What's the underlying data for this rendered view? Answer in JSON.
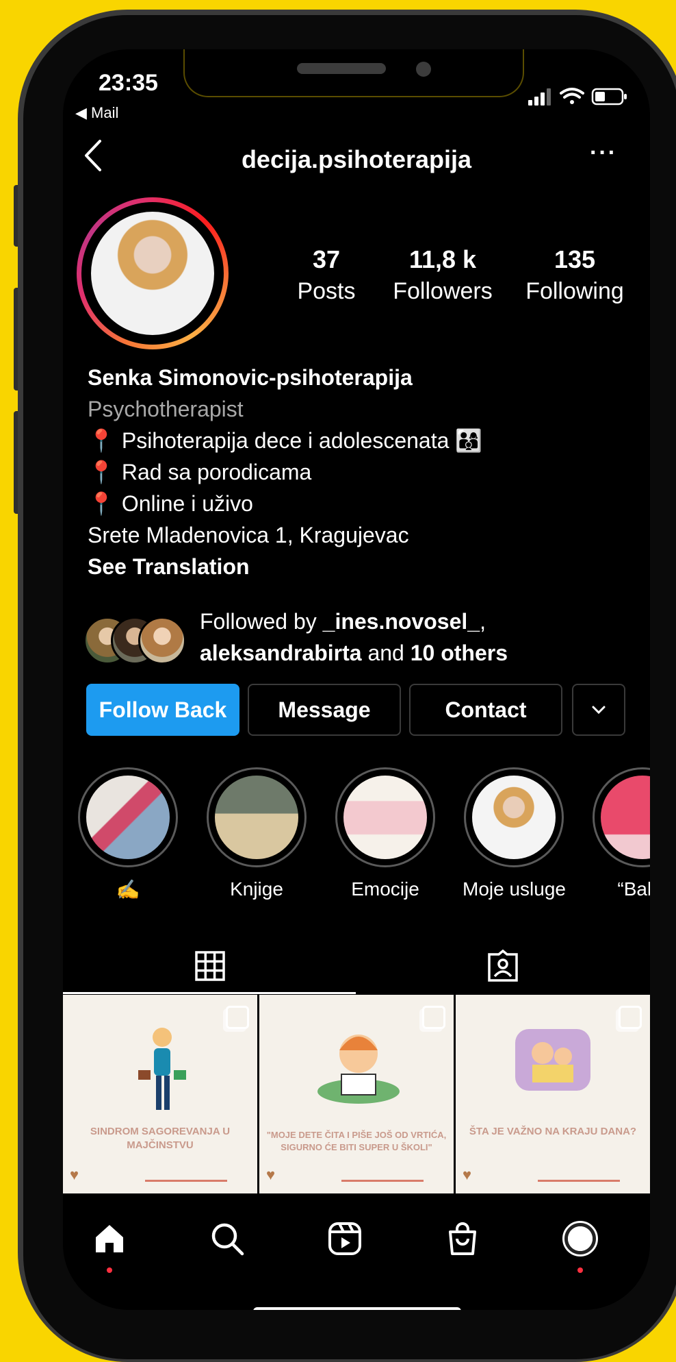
{
  "status_bar": {
    "time": "23:35",
    "back_app": "◀ Mail"
  },
  "header": {
    "username": "decija.psihoterapija",
    "more": "···"
  },
  "stats": [
    {
      "value": "37",
      "label": "Posts"
    },
    {
      "value": "11,8 k",
      "label": "Followers"
    },
    {
      "value": "135",
      "label": "Following"
    }
  ],
  "bio": {
    "name": "Senka Simonovic-psihoterapija",
    "category": "Psychotherapist",
    "lines": [
      "Psihoterapija dece i adolescenata 👨‍👩‍👦",
      "Rad sa porodicama",
      "Online i uživo"
    ],
    "address": "Srete Mladenovica 1, Kragujevac",
    "see_translation": "See Translation"
  },
  "followed_by": {
    "prefix": "Followed by ",
    "user1": "_ines.novosel_",
    "sep": ",",
    "user2": "aleksandrabirta",
    "mid": " and ",
    "others": "10 others"
  },
  "buttons": {
    "follow_back": "Follow Back",
    "message": "Message",
    "contact": "Contact",
    "more": "⌄"
  },
  "highlights": [
    {
      "label": "✍️"
    },
    {
      "label": "Knjige"
    },
    {
      "label": "Emocije"
    },
    {
      "label": "Moje usluge"
    },
    {
      "label": "“Baby"
    }
  ],
  "posts": [
    {
      "caption": "SINDROM SAGOREVANJA U MAJČINSTVU"
    },
    {
      "caption": "\"MOJE DETE ČITA I PIŠE JOŠ OD VRTIĆA, SIGURNO ĆE BITI SUPER U ŠKOLI\""
    },
    {
      "caption": "ŠTA JE VAŽNO NA KRAJU DANA?"
    }
  ],
  "colors": {
    "accent": "#1d9bf0",
    "background": "#000000",
    "frame": "#f9d500"
  }
}
